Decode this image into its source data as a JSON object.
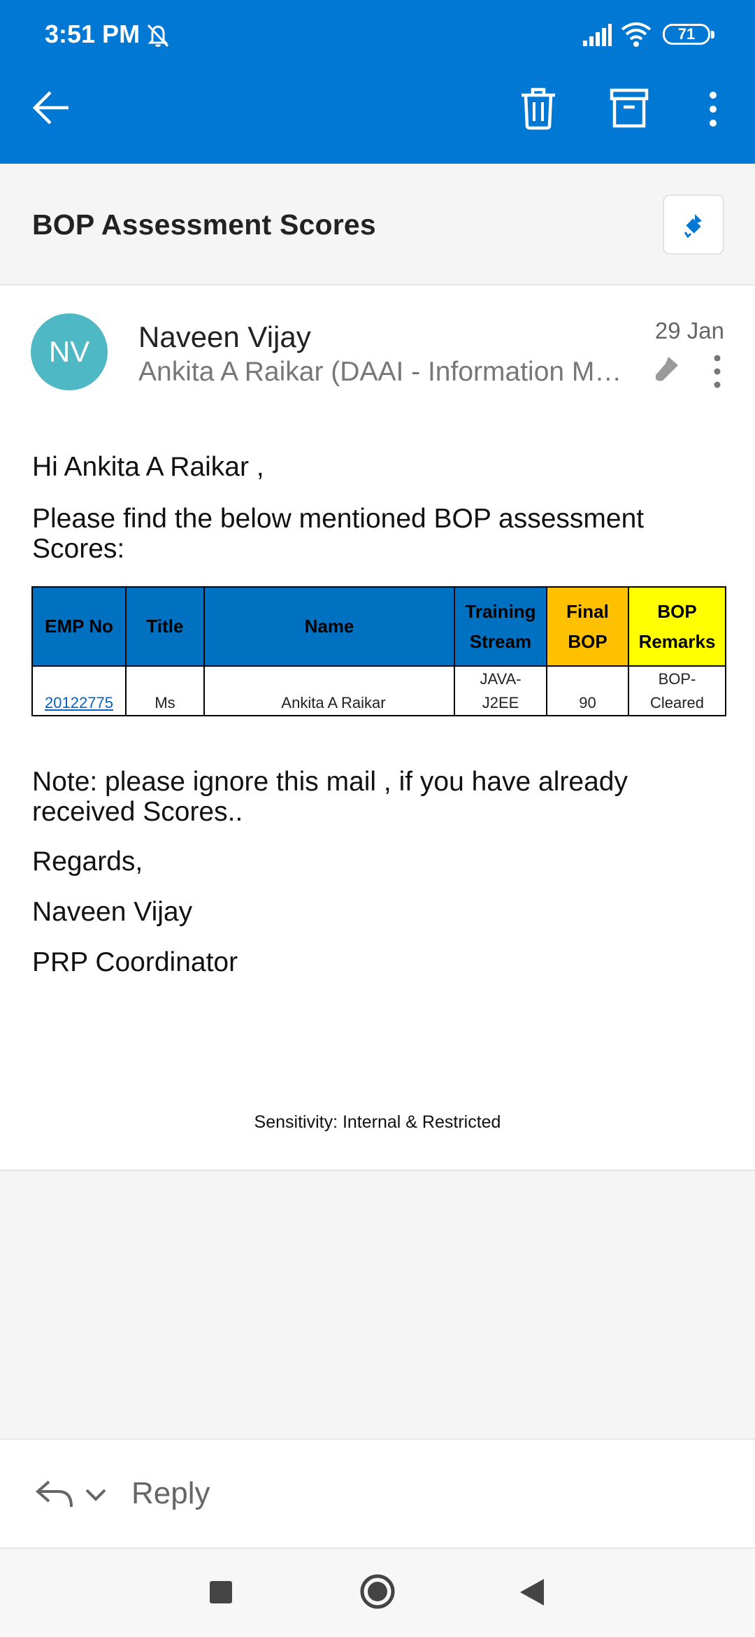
{
  "status_bar": {
    "time": "3:51 PM",
    "battery": "71"
  },
  "app_bar": {
    "icons": [
      "back-arrow-icon",
      "trash-icon",
      "archive-icon",
      "more-vertical-icon"
    ]
  },
  "email": {
    "subject": "BOP Assessment Scores",
    "sender_initials": "NV",
    "sender_name": "Naveen Vijay",
    "recipient": "Ankita A Raikar (DAAI - Information Ma...",
    "date": "29 Jan",
    "greeting": "Hi Ankita A Raikar ,",
    "intro": "Please find the below mentioned BOP assessment Scores:",
    "table": {
      "headers": [
        {
          "label": "EMP No",
          "line2": "",
          "color": "#0070c0"
        },
        {
          "label": "Title",
          "line2": "",
          "color": "#0070c0"
        },
        {
          "label": "Name",
          "line2": "",
          "color": "#0070c0"
        },
        {
          "label": "Training",
          "line2": "Stream",
          "color": "#0070c0"
        },
        {
          "label": "Final",
          "line2": "BOP",
          "color": "#ffc000"
        },
        {
          "label": "BOP",
          "line2": "Remarks",
          "color": "#ffff00"
        }
      ],
      "rows": [
        {
          "emp_no": "20122775",
          "title": "Ms",
          "name": "Ankita A Raikar",
          "stream_line1": "JAVA-",
          "stream_line2": "J2EE",
          "final_bop": "90",
          "remarks_line1": "BOP-",
          "remarks_line2": "Cleared"
        }
      ]
    },
    "note": "Note: please ignore this mail , if you have already received Scores..",
    "regards": "Regards,",
    "signature_name": "Naveen Vijay",
    "signature_role": "PRP Coordinator",
    "sensitivity": "Sensitivity: Internal & Restricted"
  },
  "reply": {
    "label": "Reply"
  },
  "colors": {
    "accent": "#0078d4",
    "avatar": "#4fb8c5",
    "link": "#0563c1"
  }
}
